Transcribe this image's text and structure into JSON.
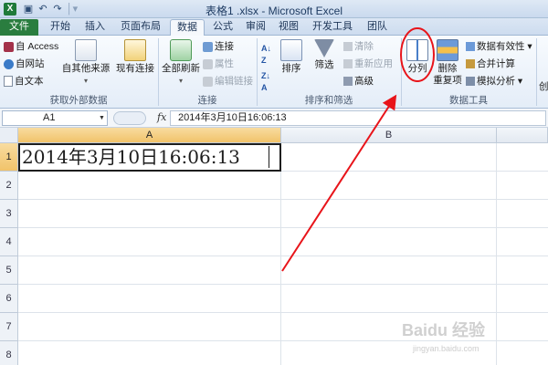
{
  "window": {
    "title": "表格1 .xlsx - Microsoft Excel",
    "app_icon": "X"
  },
  "tabs": [
    {
      "label": "文件"
    },
    {
      "label": "开始"
    },
    {
      "label": "插入"
    },
    {
      "label": "页面布局"
    },
    {
      "label": "数据"
    },
    {
      "label": "公式"
    },
    {
      "label": "审阅"
    },
    {
      "label": "视图"
    },
    {
      "label": "开发工具"
    },
    {
      "label": "团队"
    }
  ],
  "ribbon": {
    "get_external": {
      "access": "自 Access",
      "web": "自网站",
      "text": "自文本",
      "other": "自其他来源",
      "existing": "现有连接",
      "label": "获取外部数据"
    },
    "connections": {
      "refresh_all": "全部刷新",
      "connections": "连接",
      "properties": "属性",
      "edit_links": "编辑链接",
      "label": "连接"
    },
    "sort_filter": {
      "sort": "排序",
      "filter": "筛选",
      "clear": "清除",
      "reapply": "重新应用",
      "advanced": "高级",
      "label": "排序和筛选"
    },
    "data_tools": {
      "text_to_columns": "分列",
      "remove_dup_1": "删除",
      "remove_dup_2": "重复项",
      "validation": "数据有效性",
      "consolidate": "合并计算",
      "what_if": "模拟分析",
      "label": "数据工具"
    },
    "outline_partial": "创"
  },
  "formula_bar": {
    "name_box": "A1",
    "fx": "fx",
    "value": "2014年3月10日16:06:13"
  },
  "sheet": {
    "columns": [
      "A",
      "B"
    ],
    "rows": [
      "1",
      "2",
      "3",
      "4",
      "5",
      "6",
      "7",
      "8"
    ],
    "cell_a1": "2014年3月10日16:06:13"
  },
  "watermark": {
    "brand": "Baidu 经验",
    "url": "jingyan.baidu.com"
  },
  "colors": {
    "file_tab": "#2a7d3f",
    "annotation": "#e8141a",
    "selected_header": "#f1c36a"
  }
}
